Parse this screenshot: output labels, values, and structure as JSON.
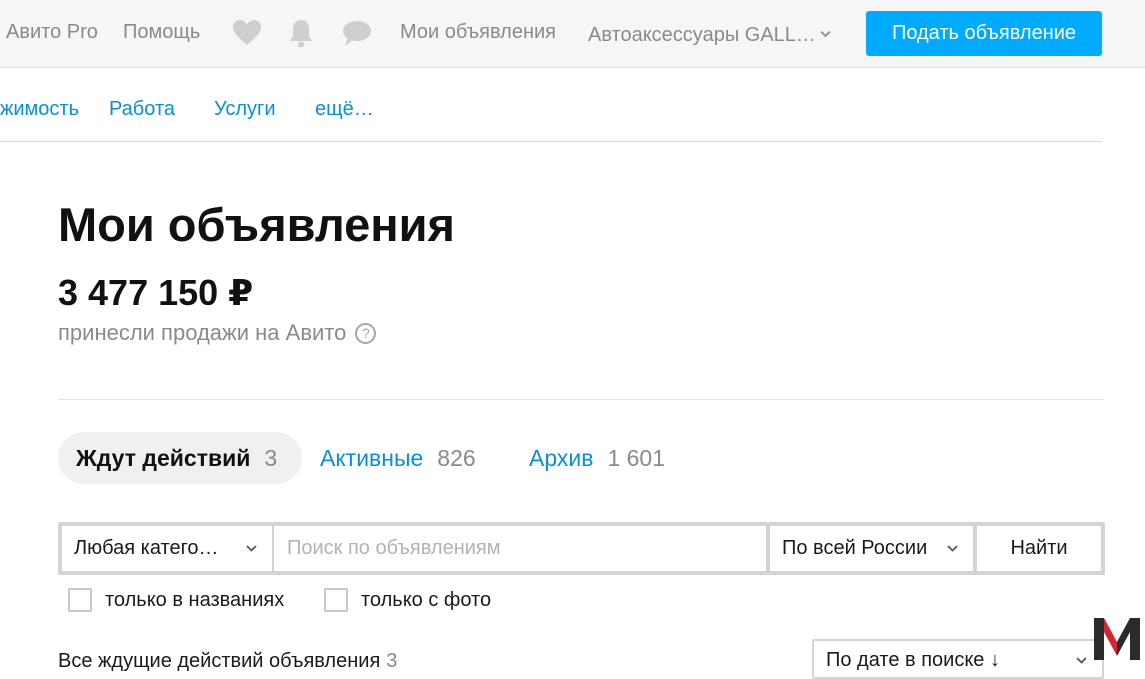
{
  "header": {
    "avito_pro": "Авито Pro",
    "help": "Помощь",
    "my_listings": "Мои объявления",
    "account_name": "Автоаксессуары GALL…",
    "post_button": "Подать объявление",
    "icons": [
      "heart-icon",
      "bell-icon",
      "chat-icon"
    ]
  },
  "categories": {
    "items": [
      "жимость",
      "Работа",
      "Услуги",
      "ещё…"
    ]
  },
  "main": {
    "title": "Мои объявления",
    "revenue": "3 477 150 ₽",
    "revenue_caption": "принесли продажи на Авито",
    "help_glyph": "?"
  },
  "tabs": [
    {
      "label": "Ждут действий",
      "count": "3",
      "active": true
    },
    {
      "label": "Активные",
      "count": "826",
      "active": false
    },
    {
      "label": "Архив",
      "count": "1 601",
      "active": false
    }
  ],
  "search": {
    "category": "Любая катего…",
    "placeholder": "Поиск по объявлениям",
    "region": "По всей России",
    "find_button": "Найти"
  },
  "filters": {
    "titles_only": "только в названиях",
    "with_photo": "только с фото"
  },
  "listings": {
    "summary": "Все ждущие действий объявления",
    "count": "3",
    "sort": "По дате в поиске ↓"
  },
  "colors": {
    "accent": "#00aaff",
    "link": "#0a8fd6",
    "muted": "#8a8a8a"
  }
}
